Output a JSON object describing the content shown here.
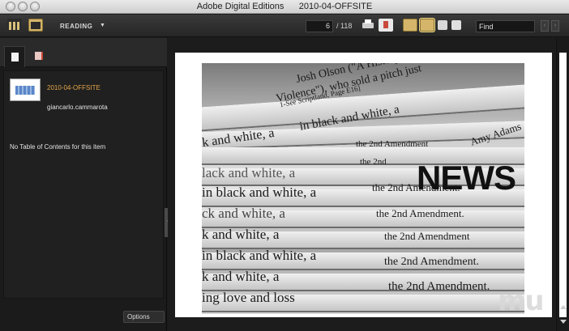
{
  "window": {
    "title": "Adobe Digital Editions      2010-04-OFFSITE"
  },
  "toolbar": {
    "view_mode_label": "READING",
    "current_page": "6",
    "page_total": "/ 118",
    "find_placeholder": "Find",
    "prev_icon": "‹",
    "next_icon": "›"
  },
  "sidebar": {
    "book_title": "2010-04-OFFSITE",
    "book_author": "giancarlo.cammarota",
    "toc_message": "No Table of Contents for this item",
    "options_label": "Options"
  },
  "cover": {
    "headline": "NEWS",
    "lines": [
      "Josh Olson (\"A History of",
      "Violence\"), who sold a pitch just",
      "1-See Scriptland, Page E16]",
      "in black and white, a",
      "Amy Adams",
      "k and white, a",
      "the 2nd Amendment",
      "lack and white, a",
      "the 2nd",
      "in black and white, a",
      "ck and white, a",
      "the 2nd Amendment.",
      "k and white, a",
      "the 2nd Amendment.",
      "in black and white, a",
      "the 2nd Amendment",
      "k and white, a",
      "the 2nd Amendment.",
      "ing love and loss",
      "the 2nd Amendment."
    ]
  },
  "watermark": "mu"
}
